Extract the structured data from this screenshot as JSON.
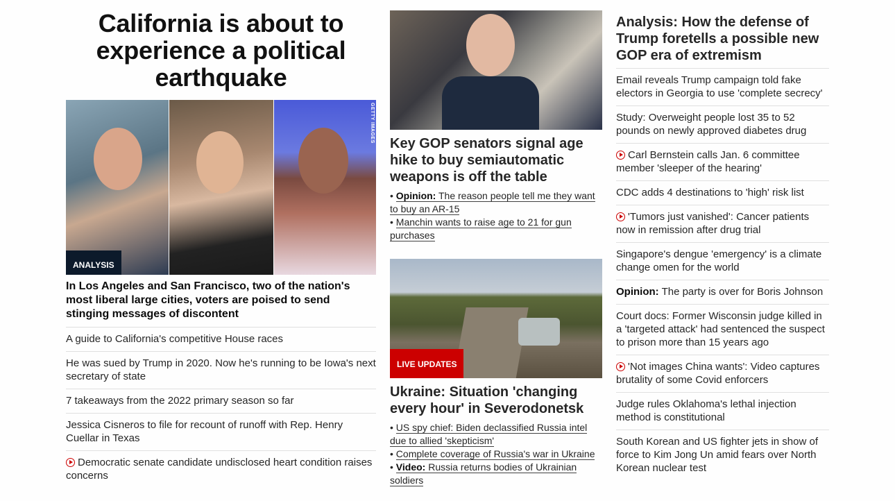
{
  "col1": {
    "headline": "California is about to experience a political earthquake",
    "image_credit": "GETTY IMAGES",
    "tag": "ANALYSIS",
    "subhead": "In Los Angeles and San Francisco, two of the nation's most liberal large cities, voters are poised to send stinging messages of discontent",
    "items": [
      {
        "text": "A guide to California's competitive House races"
      },
      {
        "text": "He was sued by Trump in 2020. Now he's running to be Iowa's next secretary of state"
      },
      {
        "text": "7 takeaways from the 2022 primary season so far"
      },
      {
        "text": "Jessica Cisneros to file for recount of runoff with Rep. Henry Cuellar in Texas"
      },
      {
        "text": "Democratic senate candidate undisclosed heart condition raises concerns",
        "video": true
      }
    ]
  },
  "col2": {
    "story1": {
      "headline": "Key GOP senators signal age hike to buy semiautomatic weapons is off the table",
      "bullets": [
        {
          "prefix": "Opinion:",
          "text": "The reason people tell me they want to buy an AR-15"
        },
        {
          "prefix": "",
          "text": "Manchin wants to raise age to 21 for gun purchases"
        }
      ]
    },
    "story2": {
      "tag": "LIVE UPDATES",
      "headline": "Ukraine: Situation 'changing every hour' in Severodonetsk",
      "bullets": [
        {
          "prefix": "",
          "text": "US spy chief: Biden declassified Russia intel due to allied 'skepticism'"
        },
        {
          "prefix": "",
          "text": "Complete coverage of Russia's war in Ukraine"
        },
        {
          "prefix": "Video:",
          "text": "Russia returns bodies of Ukrainian soldiers"
        }
      ]
    }
  },
  "col3": {
    "headline": "Analysis: How the defense of Trump foretells a possible new GOP era of extremism",
    "items": [
      {
        "prefix": "",
        "text": "Email reveals Trump campaign told fake electors in Georgia to use 'complete secrecy'"
      },
      {
        "prefix": "",
        "text": "Study: Overweight people lost 35 to 52 pounds on newly approved diabetes drug"
      },
      {
        "prefix": "",
        "text": "Carl Bernstein calls Jan. 6 committee member 'sleeper of the hearing'",
        "video": true
      },
      {
        "prefix": "",
        "text": "CDC adds 4 destinations to 'high' risk list"
      },
      {
        "prefix": "",
        "text": "'Tumors just vanished': Cancer patients now in remission after drug trial",
        "video": true
      },
      {
        "prefix": "",
        "text": "Singapore's dengue 'emergency' is a climate change omen for the world"
      },
      {
        "prefix": "Opinion:",
        "text": "The party is over for Boris Johnson"
      },
      {
        "prefix": "",
        "text": "Court docs: Former Wisconsin judge killed in a 'targeted attack' had sentenced the suspect to prison more than 15 years ago"
      },
      {
        "prefix": "",
        "text": "'Not images China wants': Video captures brutality of some Covid enforcers",
        "video": true
      },
      {
        "prefix": "",
        "text": "Judge rules Oklahoma's lethal injection method is constitutional"
      },
      {
        "prefix": "",
        "text": "South Korean and US fighter jets in show of force to Kim Jong Un amid fears over North Korean nuclear test"
      }
    ]
  },
  "colors": {
    "accent": "#cc0000",
    "analysis_tag": "#0c1a2b"
  }
}
